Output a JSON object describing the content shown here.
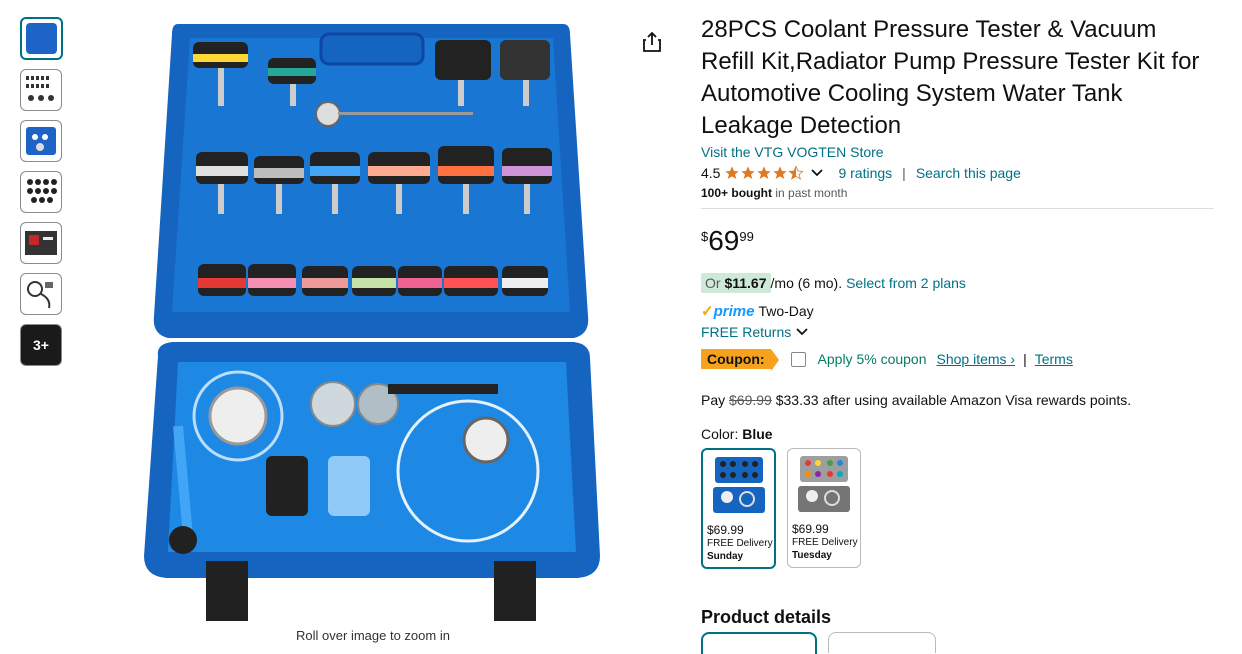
{
  "gallery": {
    "more_count": "3+",
    "caption": "Roll over image to zoom in"
  },
  "product": {
    "title": "28PCS Coolant Pressure Tester & Vacuum Refill Kit,Radiator Pump Pressure Tester Kit for Automotive Cooling System Water Tank Leakage Detection",
    "store_link": "Visit the VTG VOGTEN Store",
    "rating_value": "4.5",
    "rating_stars": 4.5,
    "ratings_count": "9 ratings",
    "search_page": "Search this page",
    "bought_bold": "100+ bought",
    "bought_rest": " in past month"
  },
  "price": {
    "symbol": "$",
    "whole": "69",
    "fraction": "99"
  },
  "monthly": {
    "or": "Or ",
    "amount": "$11.67",
    "per": "/mo (6 mo). ",
    "plans_link": "Select from 2 plans"
  },
  "delivery": {
    "prime_word": "prime",
    "two_day": "Two-Day",
    "returns": "FREE Returns"
  },
  "coupon": {
    "badge": "Coupon:",
    "apply": "Apply 5% coupon",
    "shop_items": "Shop items ›",
    "sep": "|",
    "terms": "Terms"
  },
  "visa": {
    "pay": "Pay ",
    "old_price": "$69.99",
    "rest": " $33.33 after using available Amazon Visa rewards points."
  },
  "color": {
    "label": "Color: ",
    "selected": "Blue",
    "options": [
      {
        "price": "$69.99",
        "delivery": "FREE Delivery",
        "day": "Sunday"
      },
      {
        "price": "$69.99",
        "delivery": "FREE Delivery",
        "day": "Tuesday"
      }
    ]
  },
  "details": {
    "heading": "Product details"
  },
  "colors": {
    "link": "#007185",
    "case_blue": "#1565c0",
    "coupon_orange": "#f7a21e",
    "star": "#de7921"
  }
}
